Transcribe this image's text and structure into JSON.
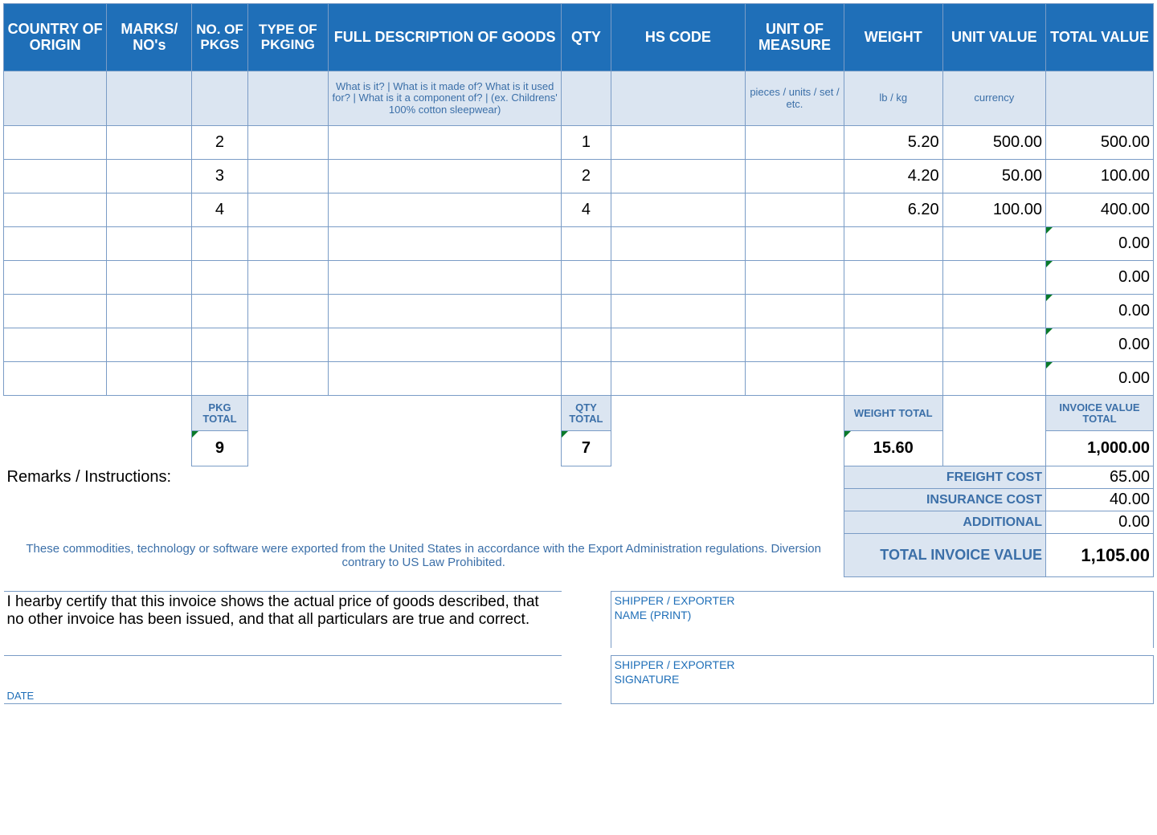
{
  "headers": {
    "country": "COUNTRY OF ORIGIN",
    "marks": "MARKS/ NO's",
    "pkgs": "NO. OF PKGS",
    "pkging": "TYPE OF PKGING",
    "desc": "FULL DESCRIPTION OF GOODS",
    "qty": "QTY",
    "hs": "HS CODE",
    "uom": "UNIT OF MEASURE",
    "weight": "WEIGHT",
    "unitval": "UNIT VALUE",
    "totalval": "TOTAL VALUE"
  },
  "hints": {
    "desc": "What is it? | What is it made of? What is it used for? | What is it a component of? | (ex. Childrens' 100% cotton sleepwear)",
    "uom": "pieces / units / set / etc.",
    "weight": "lb / kg",
    "unitval": "currency"
  },
  "rows": [
    {
      "pkgs": "2",
      "qty": "1",
      "weight": "5.20",
      "unitval": "500.00",
      "totalval": "500.00"
    },
    {
      "pkgs": "3",
      "qty": "2",
      "weight": "4.20",
      "unitval": "50.00",
      "totalval": "100.00"
    },
    {
      "pkgs": "4",
      "qty": "4",
      "weight": "6.20",
      "unitval": "100.00",
      "totalval": "400.00"
    },
    {
      "pkgs": "",
      "qty": "",
      "weight": "",
      "unitval": "",
      "totalval": "0.00"
    },
    {
      "pkgs": "",
      "qty": "",
      "weight": "",
      "unitval": "",
      "totalval": "0.00"
    },
    {
      "pkgs": "",
      "qty": "",
      "weight": "",
      "unitval": "",
      "totalval": "0.00"
    },
    {
      "pkgs": "",
      "qty": "",
      "weight": "",
      "unitval": "",
      "totalval": "0.00"
    },
    {
      "pkgs": "",
      "qty": "",
      "weight": "",
      "unitval": "",
      "totalval": "0.00"
    }
  ],
  "sub_labels": {
    "pkg": "PKG TOTAL",
    "qty": "QTY TOTAL",
    "weight": "WEIGHT TOTAL",
    "invval": "INVOICE VALUE TOTAL"
  },
  "totals": {
    "pkg": "9",
    "qty": "7",
    "weight": "15.60",
    "invval": "1,000.00"
  },
  "remarks_label": "Remarks / Instructions:",
  "costs": {
    "freight_label": "FREIGHT COST",
    "freight": "65.00",
    "ins_label": "INSURANCE COST",
    "ins": "40.00",
    "add_label": "ADDITIONAL",
    "add": "0.00",
    "tiv_label": "TOTAL INVOICE VALUE",
    "tiv": "1,105.00"
  },
  "disclaimer": "These commodities, technology or software were exported from the United States in accordance with the Export Administration regulations.  Diversion contrary to US Law Prohibited.",
  "certify": "I hearby certify that this invoice shows the actual price of goods described, that no other invoice has been issued, and that all particulars are true and correct.",
  "sign": {
    "name1": "SHIPPER / EXPORTER",
    "name2": "NAME (PRINT)",
    "sig1": "SHIPPER / EXPORTER",
    "sig2": "SIGNATURE"
  },
  "date_label": "DATE"
}
